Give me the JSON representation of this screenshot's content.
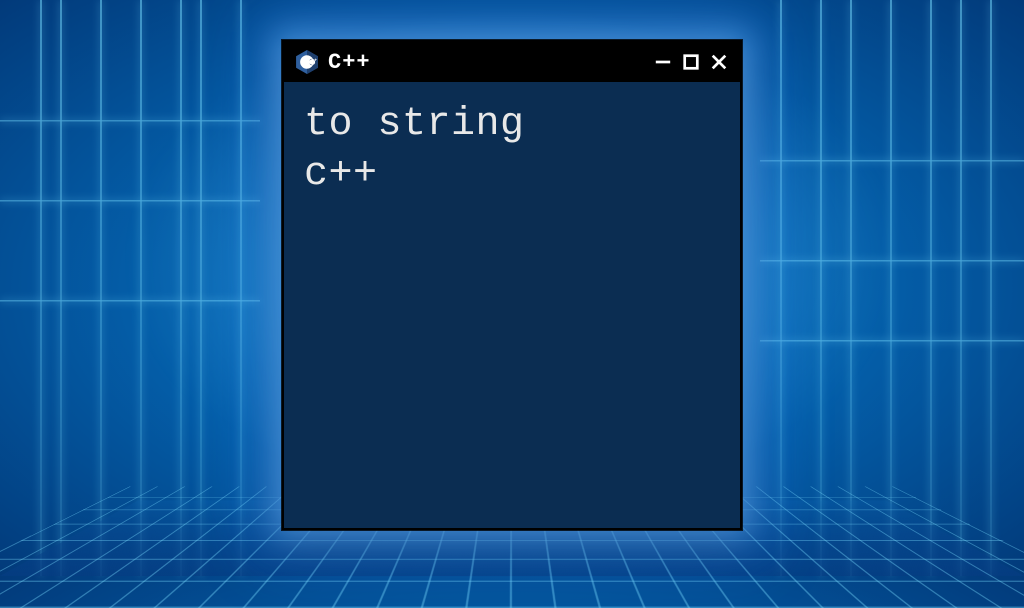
{
  "window": {
    "title": "C++",
    "logo_name": "cpp-logo-icon"
  },
  "content": {
    "line1": "to string",
    "line2": "c++"
  }
}
